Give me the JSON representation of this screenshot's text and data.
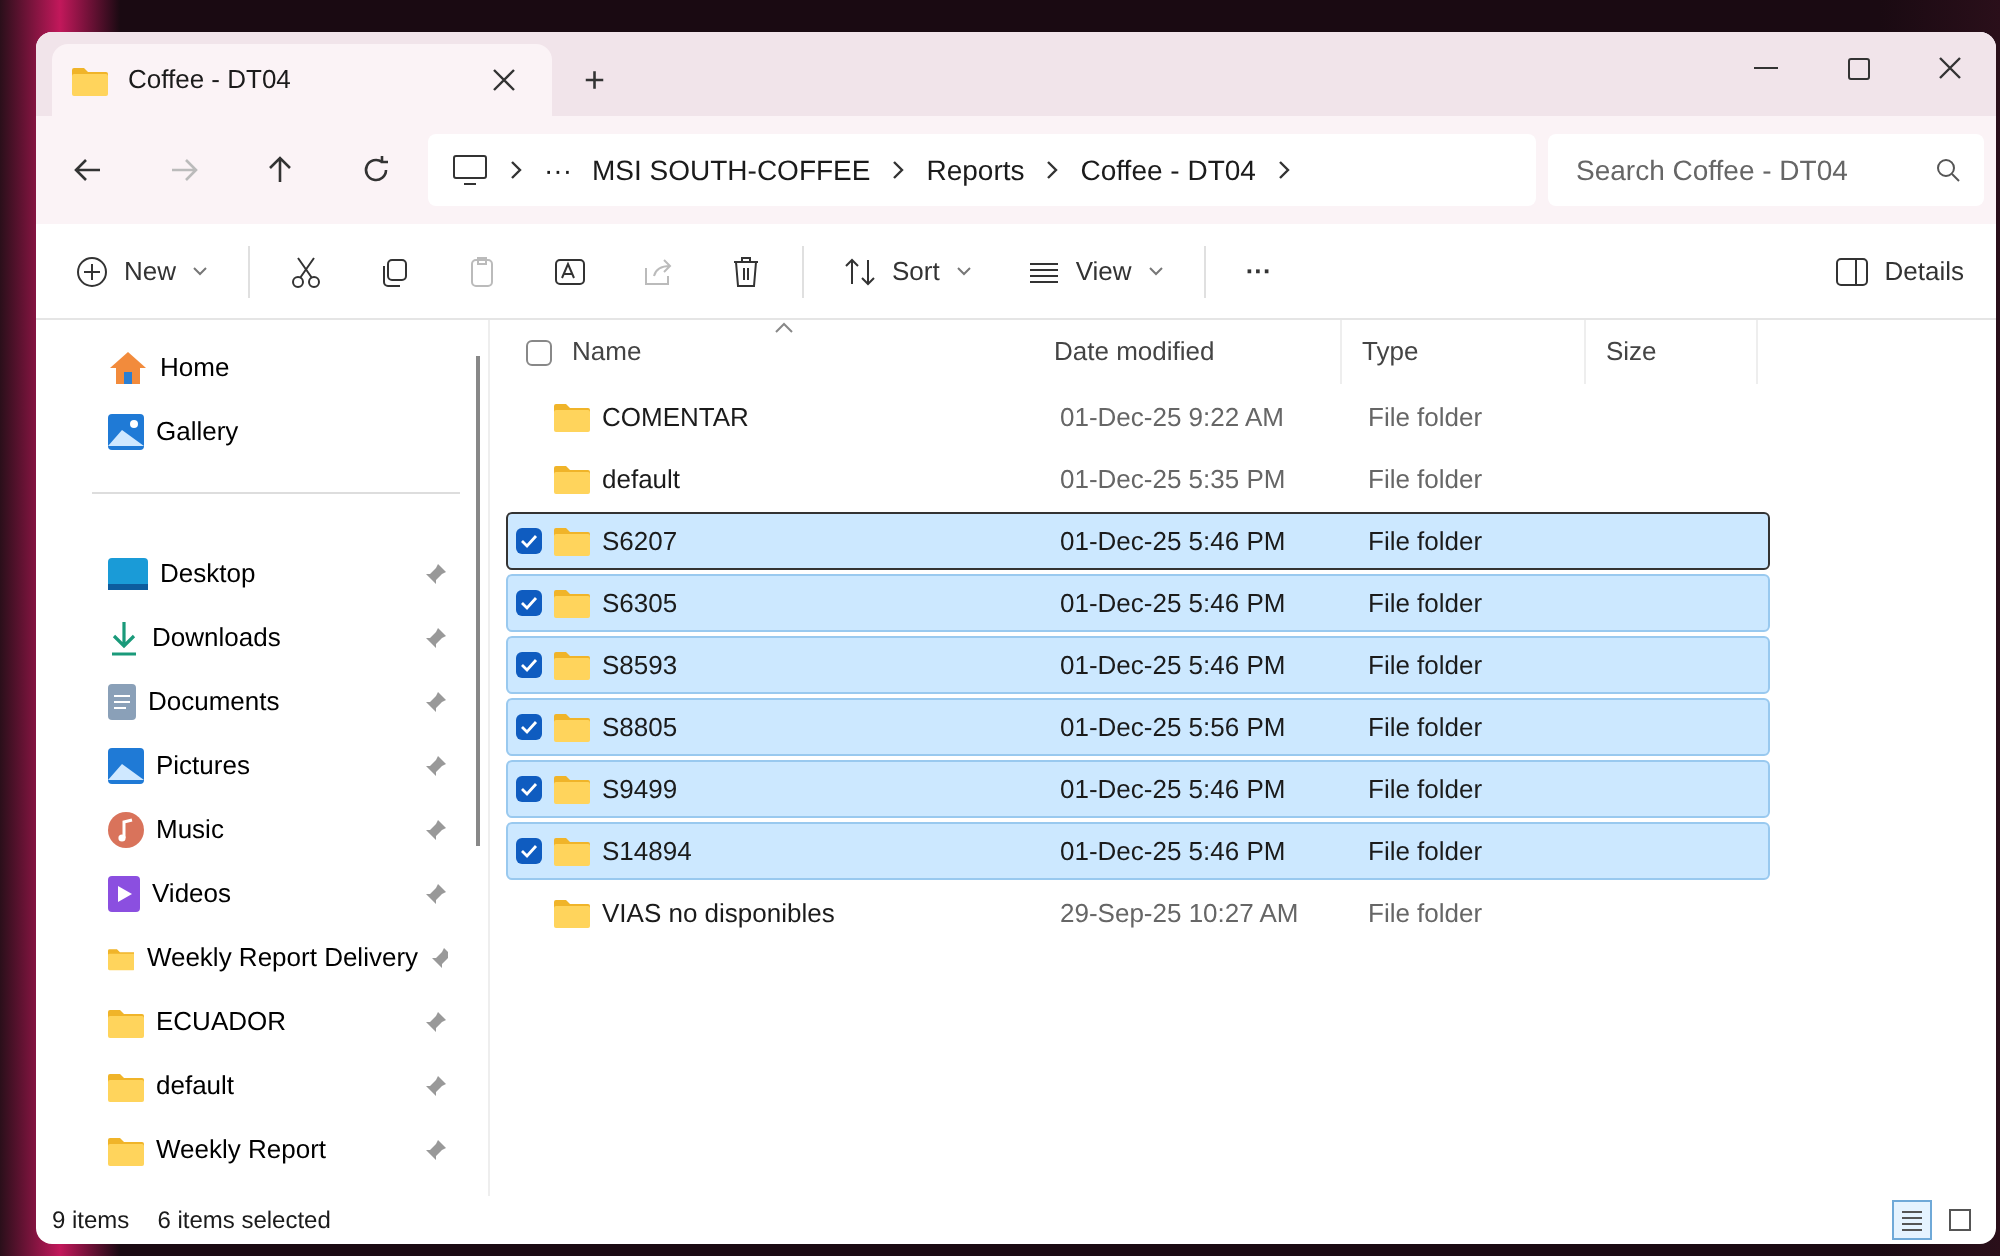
{
  "window": {
    "tab_title": "Coffee - DT04",
    "new_tab": "+"
  },
  "nav": [
    {
      "kind": "back",
      "disabled": false
    },
    {
      "kind": "forward",
      "disabled": true
    },
    {
      "kind": "up",
      "disabled": false
    },
    {
      "kind": "refresh",
      "disabled": false
    }
  ],
  "breadcrumb": {
    "overflow": "···",
    "parts": [
      "MSI SOUTH-COFFEE",
      "Reports",
      "Coffee - DT04"
    ]
  },
  "search": {
    "placeholder": "Search Coffee - DT04"
  },
  "toolbar": [
    {
      "kind": "new",
      "label": "New",
      "disabled": false
    },
    {
      "kind": "cut",
      "disabled": false
    },
    {
      "kind": "copy",
      "disabled": false
    },
    {
      "kind": "paste",
      "disabled": true
    },
    {
      "kind": "rename",
      "disabled": false
    },
    {
      "kind": "share",
      "disabled": true
    },
    {
      "kind": "delete",
      "disabled": false
    },
    {
      "kind": "sort",
      "label": "Sort",
      "disabled": false
    },
    {
      "kind": "view",
      "label": "View",
      "disabled": false
    },
    {
      "kind": "more",
      "label": "···",
      "disabled": false
    }
  ],
  "details_button": "Details",
  "sidebar": {
    "top": [
      {
        "kind": "home",
        "label": "Home"
      },
      {
        "kind": "gallery",
        "label": "Gallery"
      }
    ],
    "items": [
      {
        "kind": "desktop",
        "label": "Desktop",
        "pinned": true
      },
      {
        "kind": "downloads",
        "label": "Downloads",
        "pinned": true
      },
      {
        "kind": "documents",
        "label": "Documents",
        "pinned": true
      },
      {
        "kind": "pictures",
        "label": "Pictures",
        "pinned": true
      },
      {
        "kind": "music",
        "label": "Music",
        "pinned": true
      },
      {
        "kind": "videos",
        "label": "Videos",
        "pinned": true
      },
      {
        "kind": "folder",
        "label": "Weekly Report Delivery",
        "pinned": true
      },
      {
        "kind": "folder",
        "label": "ECUADOR",
        "pinned": true
      },
      {
        "kind": "folder",
        "label": "default",
        "pinned": true
      },
      {
        "kind": "folder",
        "label": "Weekly Report",
        "pinned": true
      }
    ]
  },
  "table": {
    "columns": [
      "Name",
      "Date modified",
      "Type",
      "Size"
    ],
    "select_all_checked": false,
    "rows": [
      {
        "name": "COMENTAR",
        "date": "01-Dec-25 9:22 AM",
        "type": "File folder",
        "selected": false,
        "focused": false
      },
      {
        "name": "default",
        "date": "01-Dec-25 5:35 PM",
        "type": "File folder",
        "selected": false,
        "focused": false
      },
      {
        "name": "S6207",
        "date": "01-Dec-25 5:46 PM",
        "type": "File folder",
        "selected": true,
        "focused": true
      },
      {
        "name": "S6305",
        "date": "01-Dec-25 5:46 PM",
        "type": "File folder",
        "selected": true,
        "focused": false
      },
      {
        "name": "S8593",
        "date": "01-Dec-25 5:46 PM",
        "type": "File folder",
        "selected": true,
        "focused": false
      },
      {
        "name": "S8805",
        "date": "01-Dec-25 5:56 PM",
        "type": "File folder",
        "selected": true,
        "focused": false
      },
      {
        "name": "S9499",
        "date": "01-Dec-25 5:46 PM",
        "type": "File folder",
        "selected": true,
        "focused": false
      },
      {
        "name": "S14894",
        "date": "01-Dec-25 5:46 PM",
        "type": "File folder",
        "selected": true,
        "focused": false
      },
      {
        "name": "VIAS no disponibles",
        "date": "29-Sep-25 10:27 AM",
        "type": "File folder",
        "selected": false,
        "focused": false
      }
    ]
  },
  "status_bar": {
    "count": "9 items",
    "selection": "6 items selected"
  },
  "view_modes": [
    {
      "kind": "details",
      "selected": true
    },
    {
      "kind": "tiles",
      "selected": false
    }
  ]
}
